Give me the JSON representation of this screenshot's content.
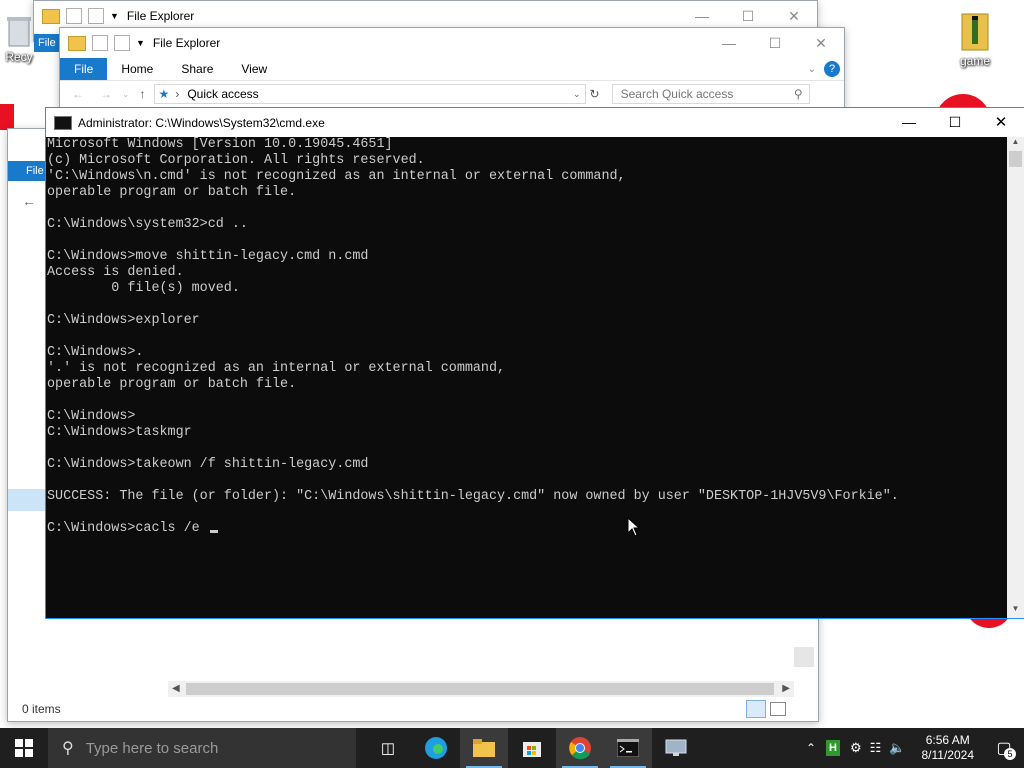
{
  "desktop": {
    "icons": [
      {
        "label": "Recy",
        "icon": "recycle-bin-icon"
      },
      {
        "label": "game",
        "icon": "folder-zip-icon"
      }
    ]
  },
  "explorer_back": {
    "title": "File Explorer"
  },
  "explorer_front": {
    "title": "File Explorer",
    "tabs": [
      "File",
      "Home",
      "Share",
      "View"
    ],
    "address": "Quick access",
    "search_placeholder": "Search Quick access",
    "status": "0 items",
    "nav_fragment": "File"
  },
  "cmd": {
    "title": "Administrator: C:\\Windows\\System32\\cmd.exe",
    "lines": [
      "Microsoft Windows [Version 10.0.19045.4651]",
      "(c) Microsoft Corporation. All rights reserved.",
      "'C:\\Windows\\n.cmd' is not recognized as an internal or external command,",
      "operable program or batch file.",
      "",
      "C:\\Windows\\system32>cd ..",
      "",
      "C:\\Windows>move shittin-legacy.cmd n.cmd",
      "Access is denied.",
      "        0 file(s) moved.",
      "",
      "C:\\Windows>explorer",
      "",
      "C:\\Windows>.",
      "'.' is not recognized as an internal or external command,",
      "operable program or batch file.",
      "",
      "C:\\Windows>",
      "C:\\Windows>taskmgr",
      "",
      "C:\\Windows>takeown /f shittin-legacy.cmd",
      "",
      "SUCCESS: The file (or folder): \"C:\\Windows\\shittin-legacy.cmd\" now owned by user \"DESKTOP-1HJV5V9\\Forkie\".",
      ""
    ],
    "prompt_line": "C:\\Windows>cacls /e "
  },
  "taskbar": {
    "search_placeholder": "Type here to search",
    "apps": [
      "task-view-icon",
      "edge-icon",
      "file-explorer-icon",
      "store-icon",
      "chrome-icon",
      "cmd-icon",
      "remote-icon"
    ],
    "clock_time": "6:56 AM",
    "clock_date": "8/11/2024",
    "notification_count": "5"
  },
  "colors": {
    "accent": "#1979ca",
    "terminal_bg": "#0c0c0c",
    "terminal_fg": "#cccccc",
    "taskbar_bg": "#1f1f1f"
  }
}
